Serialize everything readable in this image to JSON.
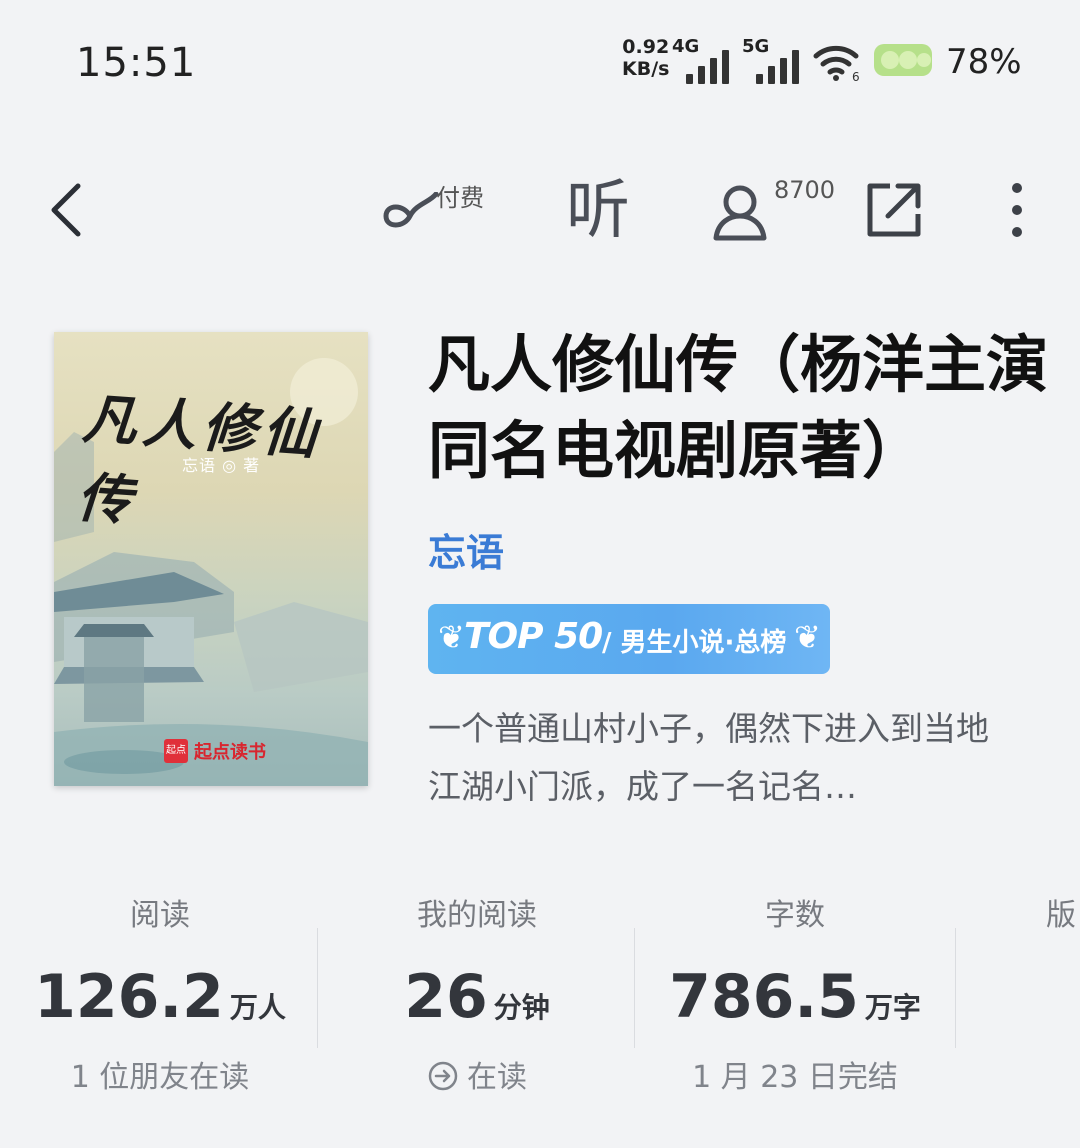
{
  "status_bar": {
    "time": "15:51",
    "net_speed_value": "0.92",
    "net_speed_unit": "KB/s",
    "signal1_label": "4G",
    "signal2_label": "5G",
    "wifi_label": "6",
    "battery_percent": "78%"
  },
  "toolbar": {
    "audio_badge": "付费",
    "listen_label": "听",
    "fans_count": "8700"
  },
  "book": {
    "cover_title": "凡人修仙传",
    "cover_author": "忘语 ◎ 著",
    "cover_logo": "起点",
    "cover_publisher": "起点读书",
    "title": "凡人修仙传（杨洋主演同名电视剧原著）",
    "author": "忘语",
    "rank_top": "TOP 50",
    "rank_label": "/ 男生小说·总榜",
    "summary": "一个普通山村小子，偶然下进入到当地江湖小门派，成了一名记名…"
  },
  "stats": [
    {
      "label": "阅读",
      "value": "126.2",
      "unit": "万人",
      "sub": "1 位朋友在读"
    },
    {
      "label": "我的阅读",
      "value": "26",
      "unit": "分钟",
      "sub": "在读"
    },
    {
      "label": "字数",
      "value": "786.5",
      "unit": "万字",
      "sub": "1 月 23 日完结"
    },
    {
      "label": "版"
    }
  ],
  "colors": {
    "background": "#f2f3f5",
    "author_link": "#3a7bd5",
    "rank_badge": "#5aa8ef"
  }
}
